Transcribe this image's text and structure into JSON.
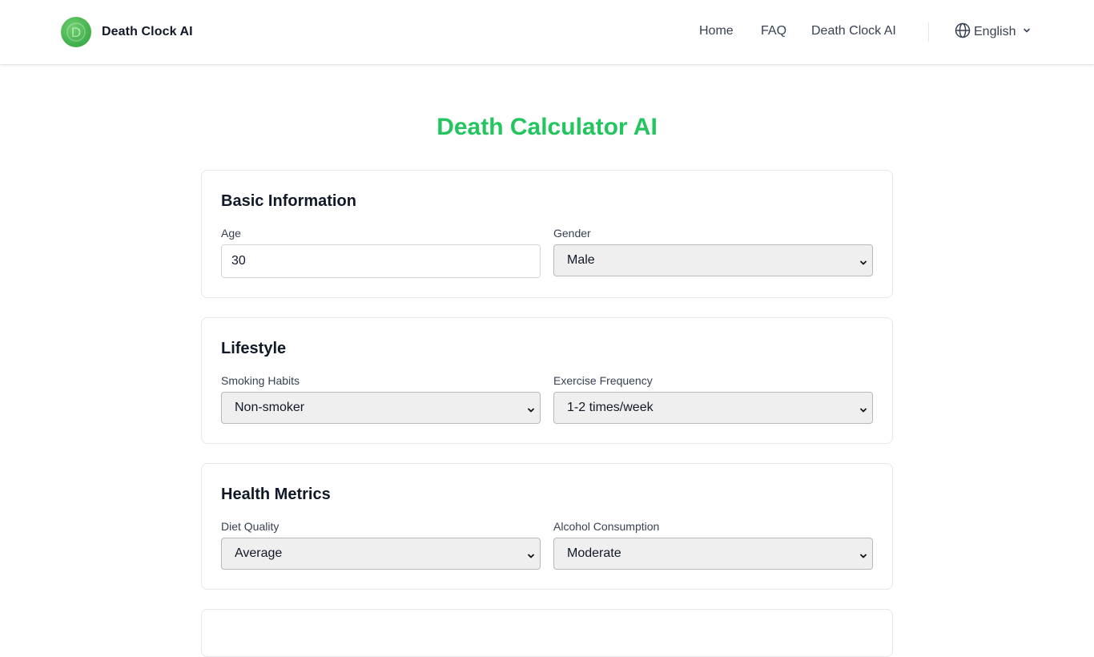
{
  "header": {
    "brand_name": "Death Clock AI",
    "logo_letter": "D",
    "nav": [
      {
        "label": "Home"
      },
      {
        "label": "FAQ"
      },
      {
        "label": "Death Clock AI"
      }
    ],
    "language": "English"
  },
  "main": {
    "title": "Death Calculator AI",
    "sections": [
      {
        "title": "Basic Information",
        "fields": [
          {
            "label": "Age",
            "value": "30"
          },
          {
            "label": "Gender",
            "value": "Male"
          }
        ]
      },
      {
        "title": "Lifestyle",
        "fields": [
          {
            "label": "Smoking Habits",
            "value": "Non-smoker"
          },
          {
            "label": "Exercise Frequency",
            "value": "1-2 times/week"
          }
        ]
      },
      {
        "title": "Health Metrics",
        "fields": [
          {
            "label": "Diet Quality",
            "value": "Average"
          },
          {
            "label": "Alcohol Consumption",
            "value": "Moderate"
          }
        ]
      }
    ]
  },
  "colors": {
    "accent": "#22c55e",
    "logo": "#3fae4a",
    "select_bg": "#efefef",
    "card_border": "#e5e7eb"
  },
  "icons": {
    "globe": "globe-icon",
    "chevron": "chevron-down-icon"
  }
}
